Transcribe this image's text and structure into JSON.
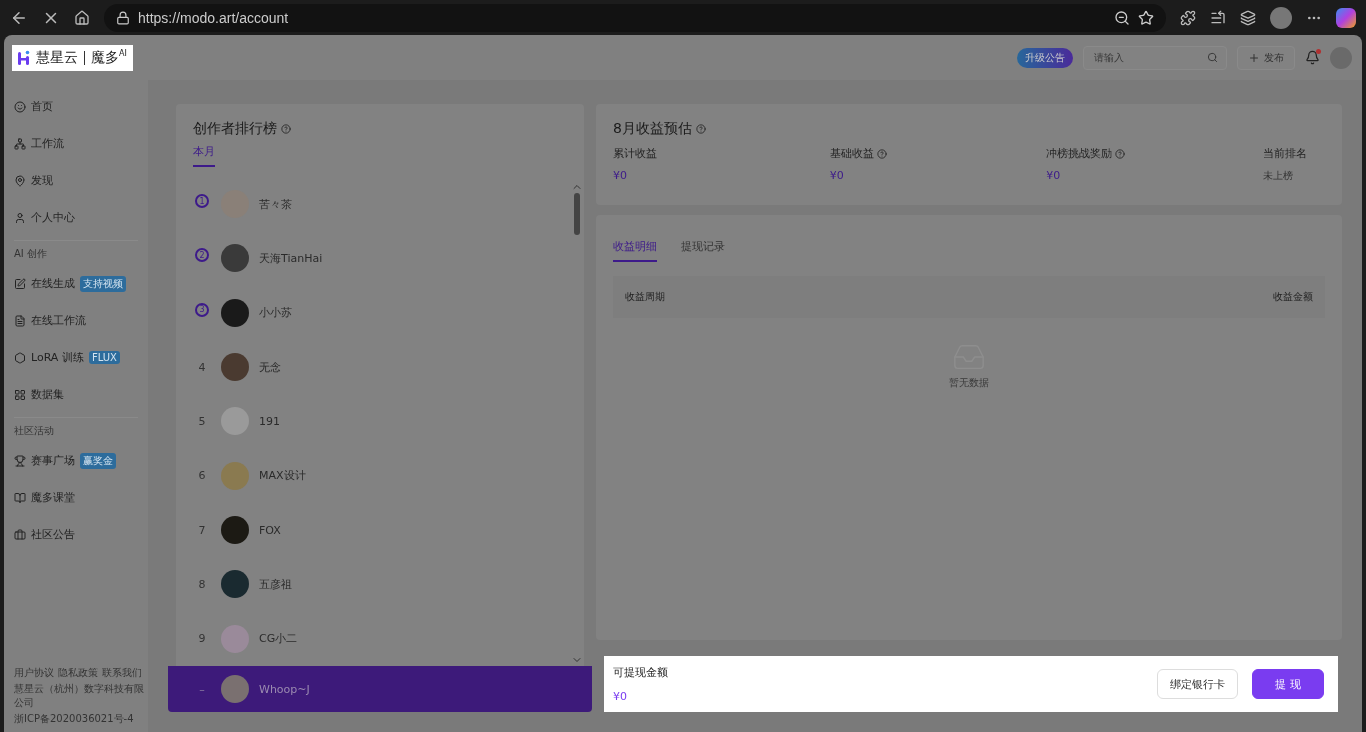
{
  "browser": {
    "url": "https://modo.art/account"
  },
  "logo": {
    "brand": "慧星云",
    "product": "魔多",
    "sup": "AI",
    "highlighted": true
  },
  "header": {
    "announcement": "升级公告",
    "search": {
      "placeholder": "请输入"
    },
    "publish": "发布",
    "has_notification": true
  },
  "sidebar": {
    "sections": [
      {
        "items": [
          {
            "label": "首页"
          },
          {
            "label": "工作流"
          },
          {
            "label": "发现"
          },
          {
            "label": "个人中心"
          }
        ]
      },
      {
        "title": "AI 创作",
        "items": [
          {
            "label": "在线生成",
            "badge": "支持视频"
          },
          {
            "label": "在线工作流"
          },
          {
            "label": "LoRA 训练",
            "badge": "FLUX"
          },
          {
            "label": "数据集"
          }
        ]
      },
      {
        "title": "社区活动",
        "items": [
          {
            "label": "赛事广场",
            "badge": "赢奖金"
          },
          {
            "label": "魔多课堂"
          },
          {
            "label": "社区公告"
          }
        ]
      }
    ],
    "footer_links": [
      "用户协议",
      "隐私政策",
      "联系我们"
    ],
    "company": "慧星云（杭州）数字科技有限公司",
    "icp": "浙ICP备2020036021号-4"
  },
  "ranking": {
    "title": "创作者排行榜",
    "tabs": [
      {
        "label": "本月",
        "selected": true
      }
    ],
    "rows": [
      {
        "kind": "medal",
        "rank": "1",
        "name": "苦々茶"
      },
      {
        "kind": "medal",
        "rank": "2",
        "name": "天海TianHai"
      },
      {
        "kind": "medal",
        "rank": "3",
        "name": "小小苏"
      },
      {
        "kind": "number",
        "rank": "4",
        "name": "无念"
      },
      {
        "kind": "number",
        "rank": "5",
        "name": "191"
      },
      {
        "kind": "number",
        "rank": "6",
        "name": "MAX设计"
      },
      {
        "kind": "number",
        "rank": "7",
        "name": "FOX"
      },
      {
        "kind": "number",
        "rank": "8",
        "name": "五彦祖"
      },
      {
        "kind": "number",
        "rank": "9",
        "name": "CG小二"
      }
    ],
    "current_user": {
      "rank": "–",
      "name": "Whoop~J"
    }
  },
  "earnings": {
    "title": "8月收益预估",
    "stats": [
      {
        "label": "累计收益",
        "value": "¥0",
        "help": false,
        "kind": "money"
      },
      {
        "label": "基础收益",
        "value": "¥0",
        "help": true,
        "kind": "money"
      },
      {
        "label": "冲榜挑战奖励",
        "value": "¥0",
        "help": true,
        "kind": "money"
      },
      {
        "label": "当前排名",
        "value": "未上榜",
        "help": false,
        "kind": "plain"
      }
    ]
  },
  "details": {
    "tabs": [
      {
        "label": "收益明细",
        "selected": true
      },
      {
        "label": "提现记录",
        "selected": false
      }
    ],
    "columns": [
      "收益周期",
      "收益金额"
    ],
    "empty_text": "暂无数据"
  },
  "withdraw": {
    "label": "可提现金额",
    "amount": "¥0",
    "bind_card": "绑定银行卡",
    "submit": "提 现",
    "highlighted": true
  }
}
